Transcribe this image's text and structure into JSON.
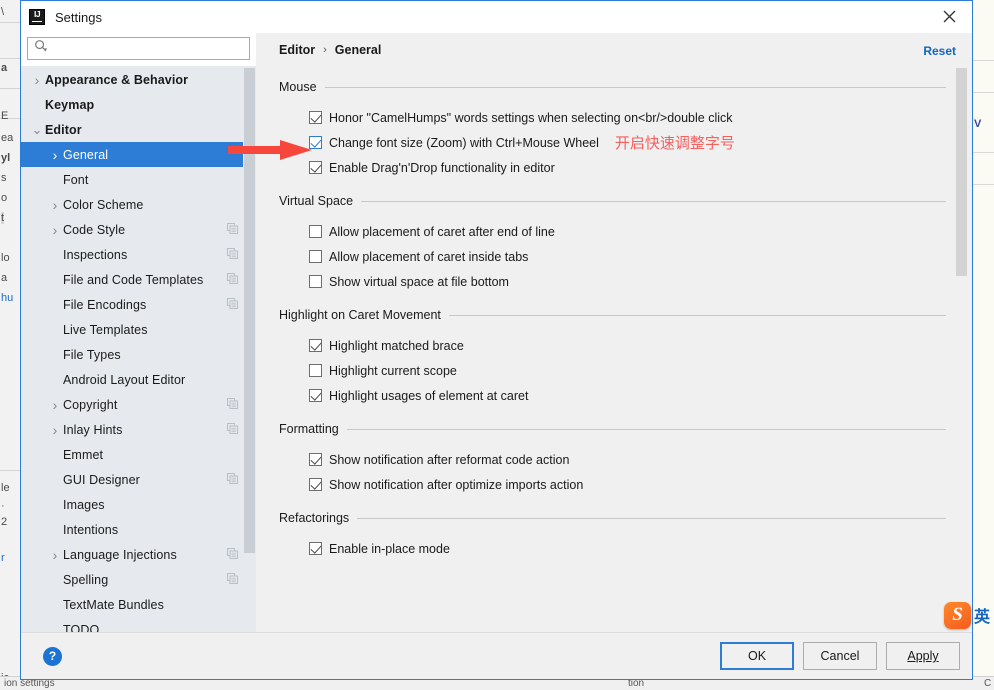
{
  "window": {
    "title": "Settings",
    "app_icon": "intellij-idea-logo",
    "close_icon": "close-icon"
  },
  "search": {
    "placeholder": "",
    "value": "",
    "icon": "search-icon"
  },
  "sidebar": {
    "scrollbar": "vertical-scrollbar",
    "items": [
      {
        "label": "Appearance & Behavior",
        "indent": 0,
        "expander": "right",
        "bold": true,
        "selected": false,
        "copy_icon": false
      },
      {
        "label": "Keymap",
        "indent": 0,
        "expander": "none",
        "bold": true,
        "selected": false,
        "copy_icon": false
      },
      {
        "label": "Editor",
        "indent": 0,
        "expander": "down",
        "bold": true,
        "selected": false,
        "copy_icon": false
      },
      {
        "label": "General",
        "indent": 1,
        "expander": "right",
        "bold": false,
        "selected": true,
        "copy_icon": false
      },
      {
        "label": "Font",
        "indent": 1,
        "expander": "none",
        "bold": false,
        "selected": false,
        "copy_icon": false
      },
      {
        "label": "Color Scheme",
        "indent": 1,
        "expander": "right",
        "bold": false,
        "selected": false,
        "copy_icon": false
      },
      {
        "label": "Code Style",
        "indent": 1,
        "expander": "right",
        "bold": false,
        "selected": false,
        "copy_icon": true
      },
      {
        "label": "Inspections",
        "indent": 1,
        "expander": "none",
        "bold": false,
        "selected": false,
        "copy_icon": true
      },
      {
        "label": "File and Code Templates",
        "indent": 1,
        "expander": "none",
        "bold": false,
        "selected": false,
        "copy_icon": true
      },
      {
        "label": "File Encodings",
        "indent": 1,
        "expander": "none",
        "bold": false,
        "selected": false,
        "copy_icon": true
      },
      {
        "label": "Live Templates",
        "indent": 1,
        "expander": "none",
        "bold": false,
        "selected": false,
        "copy_icon": false
      },
      {
        "label": "File Types",
        "indent": 1,
        "expander": "none",
        "bold": false,
        "selected": false,
        "copy_icon": false
      },
      {
        "label": "Android Layout Editor",
        "indent": 1,
        "expander": "none",
        "bold": false,
        "selected": false,
        "copy_icon": false
      },
      {
        "label": "Copyright",
        "indent": 1,
        "expander": "right",
        "bold": false,
        "selected": false,
        "copy_icon": true
      },
      {
        "label": "Inlay Hints",
        "indent": 1,
        "expander": "right",
        "bold": false,
        "selected": false,
        "copy_icon": true
      },
      {
        "label": "Emmet",
        "indent": 1,
        "expander": "none",
        "bold": false,
        "selected": false,
        "copy_icon": false
      },
      {
        "label": "GUI Designer",
        "indent": 1,
        "expander": "none",
        "bold": false,
        "selected": false,
        "copy_icon": true
      },
      {
        "label": "Images",
        "indent": 1,
        "expander": "none",
        "bold": false,
        "selected": false,
        "copy_icon": false
      },
      {
        "label": "Intentions",
        "indent": 1,
        "expander": "none",
        "bold": false,
        "selected": false,
        "copy_icon": false
      },
      {
        "label": "Language Injections",
        "indent": 1,
        "expander": "right",
        "bold": false,
        "selected": false,
        "copy_icon": true
      },
      {
        "label": "Spelling",
        "indent": 1,
        "expander": "none",
        "bold": false,
        "selected": false,
        "copy_icon": true
      },
      {
        "label": "TextMate Bundles",
        "indent": 1,
        "expander": "none",
        "bold": false,
        "selected": false,
        "copy_icon": false
      },
      {
        "label": "TODO",
        "indent": 1,
        "expander": "none",
        "bold": false,
        "selected": false,
        "copy_icon": false
      }
    ]
  },
  "breadcrumb": {
    "parent": "Editor",
    "separator": "›",
    "current": "General"
  },
  "reset_link": "Reset",
  "sections": [
    {
      "title": "Mouse",
      "options": [
        {
          "label": "Honor \"CamelHumps\" words settings when selecting on<br/>double click",
          "checked": true,
          "accent": false,
          "annotation": ""
        },
        {
          "label": "Change font size (Zoom) with Ctrl+Mouse Wheel",
          "checked": true,
          "accent": true,
          "annotation": "开启快速调整字号"
        },
        {
          "label": "Enable Drag'n'Drop functionality in editor",
          "checked": true,
          "accent": false,
          "annotation": ""
        }
      ]
    },
    {
      "title": "Virtual Space",
      "options": [
        {
          "label": "Allow placement of caret after end of line",
          "checked": false,
          "accent": false,
          "annotation": ""
        },
        {
          "label": "Allow placement of caret inside tabs",
          "checked": false,
          "accent": false,
          "annotation": ""
        },
        {
          "label": "Show virtual space at file bottom",
          "checked": false,
          "accent": false,
          "annotation": ""
        }
      ]
    },
    {
      "title": "Highlight on Caret Movement",
      "options": [
        {
          "label": "Highlight matched brace",
          "checked": true,
          "accent": false,
          "annotation": ""
        },
        {
          "label": "Highlight current scope",
          "checked": false,
          "accent": false,
          "annotation": ""
        },
        {
          "label": "Highlight usages of element at caret",
          "checked": true,
          "accent": false,
          "annotation": ""
        }
      ]
    },
    {
      "title": "Formatting",
      "options": [
        {
          "label": "Show notification after reformat code action",
          "checked": true,
          "accent": false,
          "annotation": ""
        },
        {
          "label": "Show notification after optimize imports action",
          "checked": true,
          "accent": false,
          "annotation": ""
        }
      ]
    },
    {
      "title": "Refactorings",
      "options": [
        {
          "label": "Enable in-place mode",
          "checked": true,
          "accent": false,
          "annotation": ""
        }
      ]
    }
  ],
  "footer": {
    "help_label": "?",
    "ok_label": "OK",
    "cancel_label": "Cancel",
    "apply_label": "Apply"
  },
  "annotations": {
    "arrow_color": "#f7463c",
    "text_color": "#f4605e",
    "accent_color": "#2d7cd6",
    "selection_color": "#2d7cd6",
    "link_color": "#1066c0"
  },
  "ime_badge": {
    "icon": "sogou-logo-icon",
    "label": "英"
  },
  "backdrop": {
    "left_fragments": [
      "\\",
      "a",
      "E",
      "ea",
      "yl",
      "s",
      "o",
      "t",
      "lo",
      "a",
      "hu",
      "le",
      "·",
      "2",
      "r",
      "ic"
    ],
    "right_fragments": [
      "V"
    ],
    "bottom_fragments": [
      "ion settings",
      "tion",
      "C"
    ]
  }
}
